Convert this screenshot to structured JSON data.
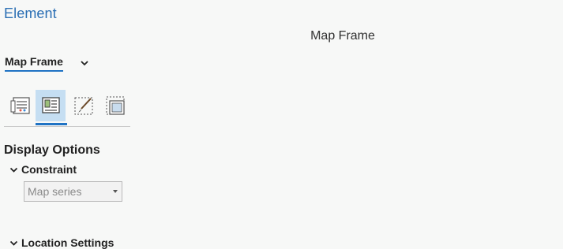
{
  "pane": {
    "title": "Element",
    "header_label": "Map Frame"
  },
  "element_selector": {
    "value": "Map Frame",
    "icon": "chevron-down-icon"
  },
  "tabs": [
    {
      "name": "options",
      "icon": "options-list-icon",
      "active": false
    },
    {
      "name": "display",
      "icon": "display-options-icon",
      "active": true
    },
    {
      "name": "symbology",
      "icon": "paintbrush-icon",
      "active": false
    },
    {
      "name": "placement",
      "icon": "placement-icon",
      "active": false
    }
  ],
  "section": {
    "title": "Display Options"
  },
  "constraint": {
    "label": "Constraint",
    "dropdown_value": "Map series"
  },
  "location_settings": {
    "label": "Location Settings"
  },
  "colors": {
    "accent": "#1f73c4",
    "title": "#2b6fb4",
    "active_tab_bg": "#c5def2"
  }
}
